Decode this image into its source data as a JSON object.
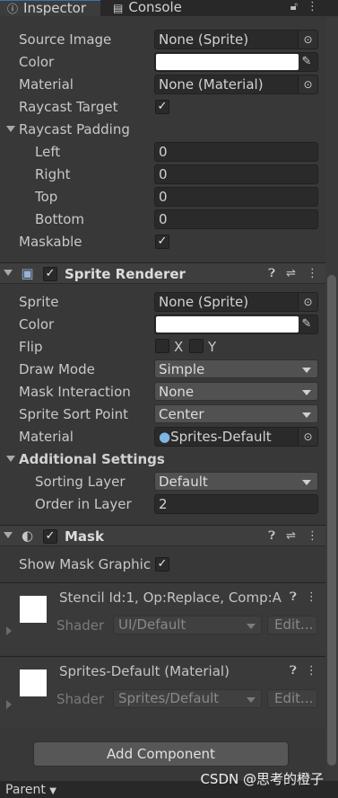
{
  "tabs": {
    "inspector": "Inspector",
    "console": "Console"
  },
  "image": {
    "source_image_label": "Source Image",
    "source_image_value": "None (Sprite)",
    "color_label": "Color",
    "material_label": "Material",
    "material_value": "None (Material)",
    "raycast_target_label": "Raycast Target",
    "raycast_padding_label": "Raycast Padding",
    "left_label": "Left",
    "left_value": "0",
    "right_label": "Right",
    "right_value": "0",
    "top_label": "Top",
    "top_value": "0",
    "bottom_label": "Bottom",
    "bottom_value": "0",
    "maskable_label": "Maskable"
  },
  "sprite_renderer": {
    "title": "Sprite Renderer",
    "sprite_label": "Sprite",
    "sprite_value": "None (Sprite)",
    "color_label": "Color",
    "flip_label": "Flip",
    "flip_x": "X",
    "flip_y": "Y",
    "draw_mode_label": "Draw Mode",
    "draw_mode_value": "Simple",
    "mask_interaction_label": "Mask Interaction",
    "mask_interaction_value": "None",
    "sort_point_label": "Sprite Sort Point",
    "sort_point_value": "Center",
    "material_label": "Material",
    "material_value": "Sprites-Default",
    "additional_settings": "Additional Settings",
    "sorting_layer_label": "Sorting Layer",
    "sorting_layer_value": "Default",
    "order_label": "Order in Layer",
    "order_value": "2"
  },
  "mask": {
    "title": "Mask",
    "show_graphic_label": "Show Mask Graphic"
  },
  "materials": [
    {
      "title": "Stencil Id:1, Op:Replace, Comp:A",
      "shader_label": "Shader",
      "shader_value": "UI/Default",
      "edit": "Edit..."
    },
    {
      "title": "Sprites-Default (Material)",
      "shader_label": "Shader",
      "shader_value": "Sprites/Default",
      "edit": "Edit..."
    }
  ],
  "add_component": "Add Component",
  "bottom": {
    "parent": "Parent"
  },
  "watermark": "CSDN @思考的橙子",
  "colors": {
    "background": "#383838",
    "header": "#3e3e3e",
    "field": "#2a2a2a",
    "dropdown": "#515151",
    "accent": "#3a72b0"
  }
}
